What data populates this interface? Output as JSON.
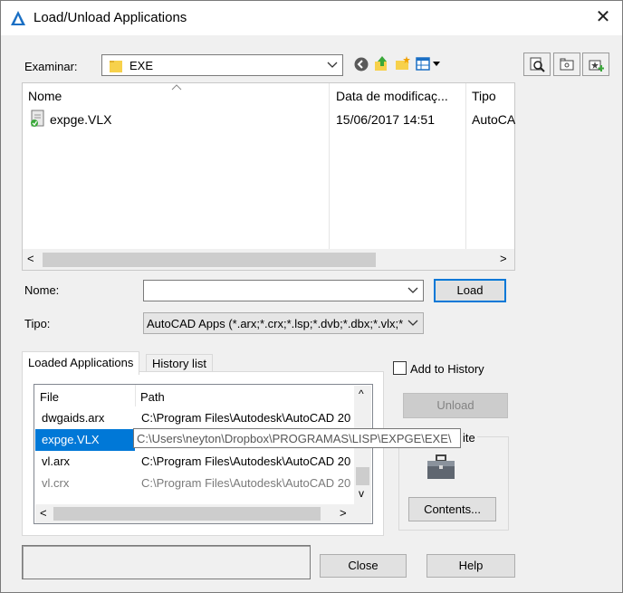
{
  "window": {
    "title": "Load/Unload Applications",
    "close_glyph": "✕"
  },
  "browse": {
    "examinar_label": "Examinar:",
    "folder_value": "EXE",
    "toolbar_icons": [
      "back-icon",
      "up-folder-icon",
      "new-folder-icon",
      "view-menu-icon"
    ],
    "right_icons": [
      "find-icon",
      "browse-folder-icon",
      "add-favorite-icon"
    ]
  },
  "filelist": {
    "columns": [
      "Nome",
      "Data de modificaç...",
      "Tipo"
    ],
    "files": [
      {
        "name": "expge.VLX",
        "modified": "15/06/2017 14:51",
        "type": "AutoCAD"
      }
    ],
    "scroll_left": "<",
    "scroll_right": ">"
  },
  "form": {
    "nome_label": "Nome:",
    "nome_value": "",
    "load_button": "Load",
    "tipo_label": "Tipo:",
    "tipo_value": "AutoCAD Apps (*.arx;*.crx;*.lsp;*.dvb;*.dbx;*.vlx;*"
  },
  "tabs": {
    "loaded": "Loaded Applications",
    "history": "History list"
  },
  "applist": {
    "columns": [
      "File",
      "Path"
    ],
    "rows": [
      {
        "file": "dwgaids.arx",
        "path": "C:\\Program Files\\Autodesk\\AutoCAD 20"
      },
      {
        "file": "expge.VLX",
        "path": "C:\\Users\\neyton\\Dropbox\\PROGRAMAS\\LISP\\EXPGE\\EXE\\"
      },
      {
        "file": "vl.arx",
        "path": "C:\\Program Files\\Autodesk\\AutoCAD 20"
      },
      {
        "file": "vl.crx",
        "path": "C:\\Program Files\\Autodesk\\AutoCAD 20"
      }
    ],
    "selected_index": 1,
    "tooltip": "C:\\Users\\neyton\\Dropbox\\PROGRAMAS\\LISP\\EXPGE\\EXE\\",
    "scroll_up": "^",
    "scroll_down": "v",
    "scroll_left": "<",
    "scroll_right": ">"
  },
  "right_panel": {
    "add_history_label": "Add to History",
    "add_history_checked": false,
    "unload_button": "Unload",
    "group_label_fragment": "ite",
    "briefcase_icon": "briefcase-icon",
    "contents_button": "Contents..."
  },
  "footer": {
    "status_text": "",
    "close_button": "Close",
    "help_button": "Help"
  },
  "colors": {
    "selection": "#0078d7",
    "accent_blue": "#0078d7",
    "folder_yellow": "#f7d14b"
  }
}
